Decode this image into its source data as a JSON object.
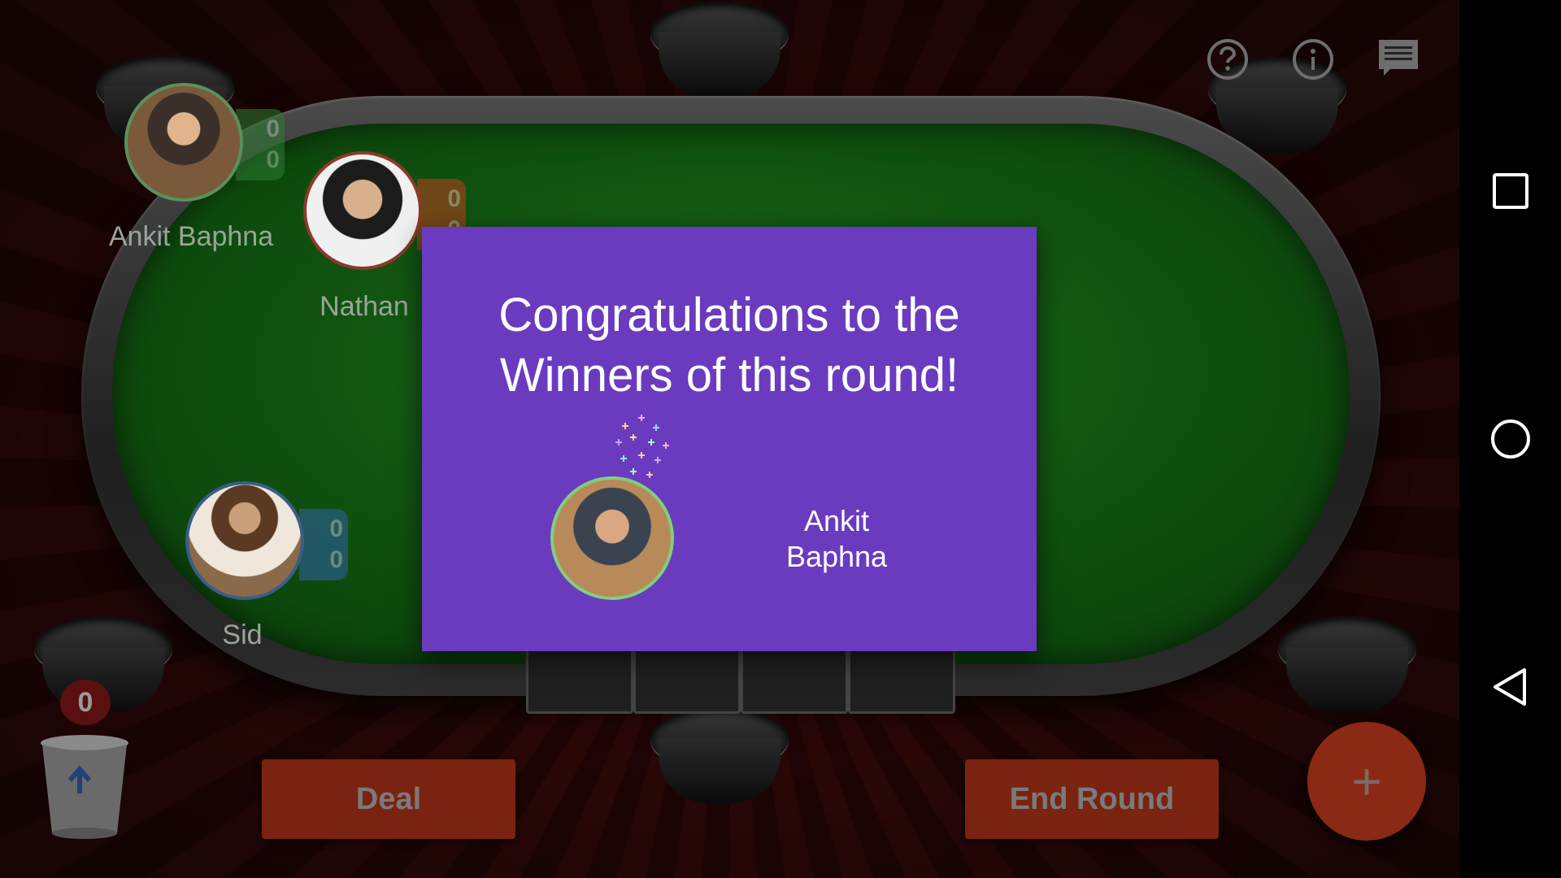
{
  "players": [
    {
      "name": "Ankit Baphna",
      "chips": "0",
      "bet": "0",
      "tag_color": "#2e7d32"
    },
    {
      "name": "Nathan",
      "chips": "0",
      "bet": "0",
      "tag_color": "#b0401e"
    },
    {
      "name": "Sid",
      "chips": "0",
      "bet": "0",
      "tag_color": "#2f5f9a"
    }
  ],
  "top_icons": [
    "help-icon",
    "info-icon",
    "chat-icon"
  ],
  "buttons": {
    "deal": "Deal",
    "end_round": "End Round",
    "fab": "+"
  },
  "discard": {
    "count": "0"
  },
  "dialog": {
    "title": "Congratulations to the Winners of this round!",
    "winner_name": "Ankit Baphna"
  },
  "nav": [
    "recents-icon",
    "home-icon",
    "back-icon"
  ],
  "colors": {
    "dialog_bg": "#6a3bbf",
    "felt": "#0f500f",
    "button_bg": "#7a2310"
  }
}
